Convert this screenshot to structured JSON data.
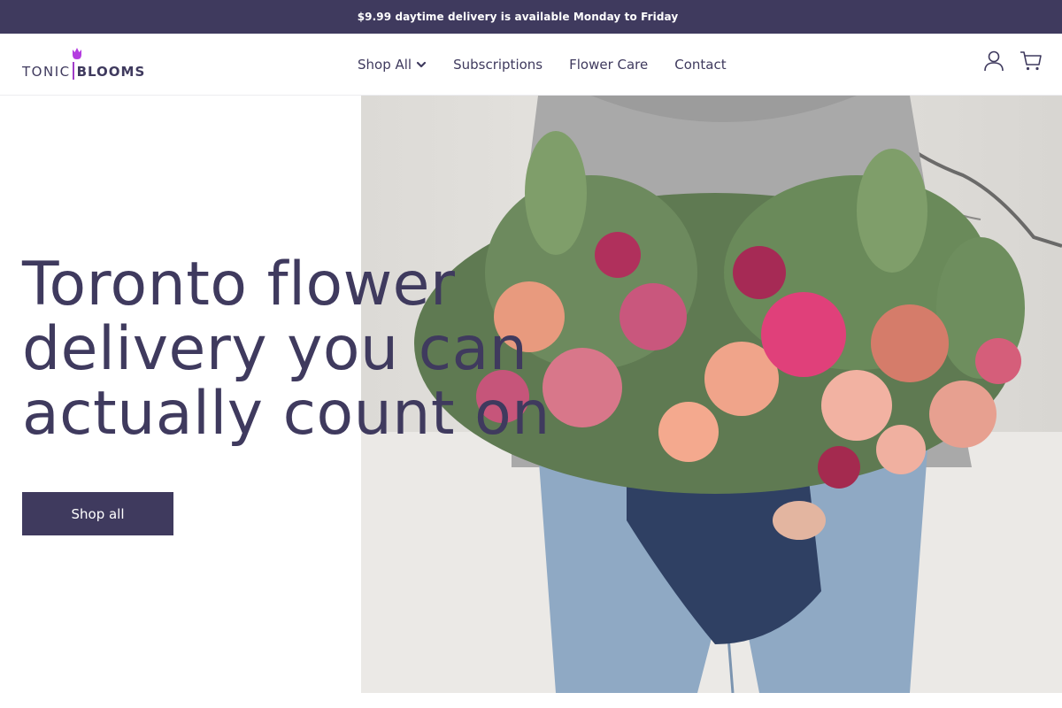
{
  "announcement": {
    "text": "$9.99 daytime delivery is available Monday to Friday"
  },
  "header": {
    "logo": {
      "word1": "TONIC",
      "word2": "BLOOMS",
      "icon": "tulip-icon"
    },
    "nav": [
      {
        "label": "Shop All",
        "has_dropdown": true
      },
      {
        "label": "Subscriptions"
      },
      {
        "label": "Flower Care"
      },
      {
        "label": "Contact"
      }
    ],
    "icons": [
      "account-icon",
      "cart-icon"
    ]
  },
  "hero": {
    "title_lines": [
      "Toronto flower",
      "delivery you can",
      "actually count on"
    ],
    "button_label": "Shop all",
    "image": "bouquet-photo"
  },
  "colors": {
    "brand": "#3f3a5e",
    "accent": "#a03cc8",
    "background": "#ffffff"
  }
}
